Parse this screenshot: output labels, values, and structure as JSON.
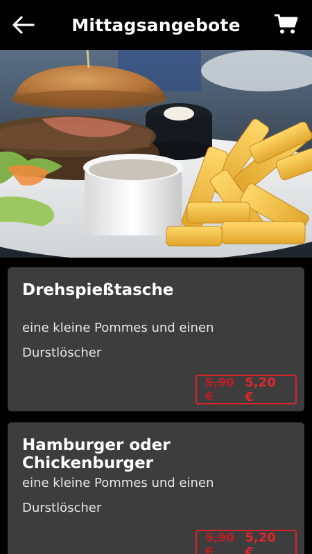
{
  "header": {
    "title": "Mittagsangebote",
    "back_icon": "arrow-left-icon",
    "cart_icon": "shopping-cart-icon"
  },
  "hero": {
    "image": "burger-and-fries-photo"
  },
  "offers": [
    {
      "name": "Drehspießtasche",
      "description": "eine kleine Pommes und einen Durstlöscher",
      "old_price": "5,90 €",
      "new_price": "5,20 €"
    },
    {
      "name": "Hamburger oder Chickenburger",
      "description": "eine kleine Pommes und einen Durstlöscher",
      "old_price": "5,90 €",
      "new_price": "5,20 €"
    }
  ],
  "colors": {
    "card_bg": "#3d3d3d",
    "price_accent": "#d9252a",
    "header_bg": "#000000"
  }
}
